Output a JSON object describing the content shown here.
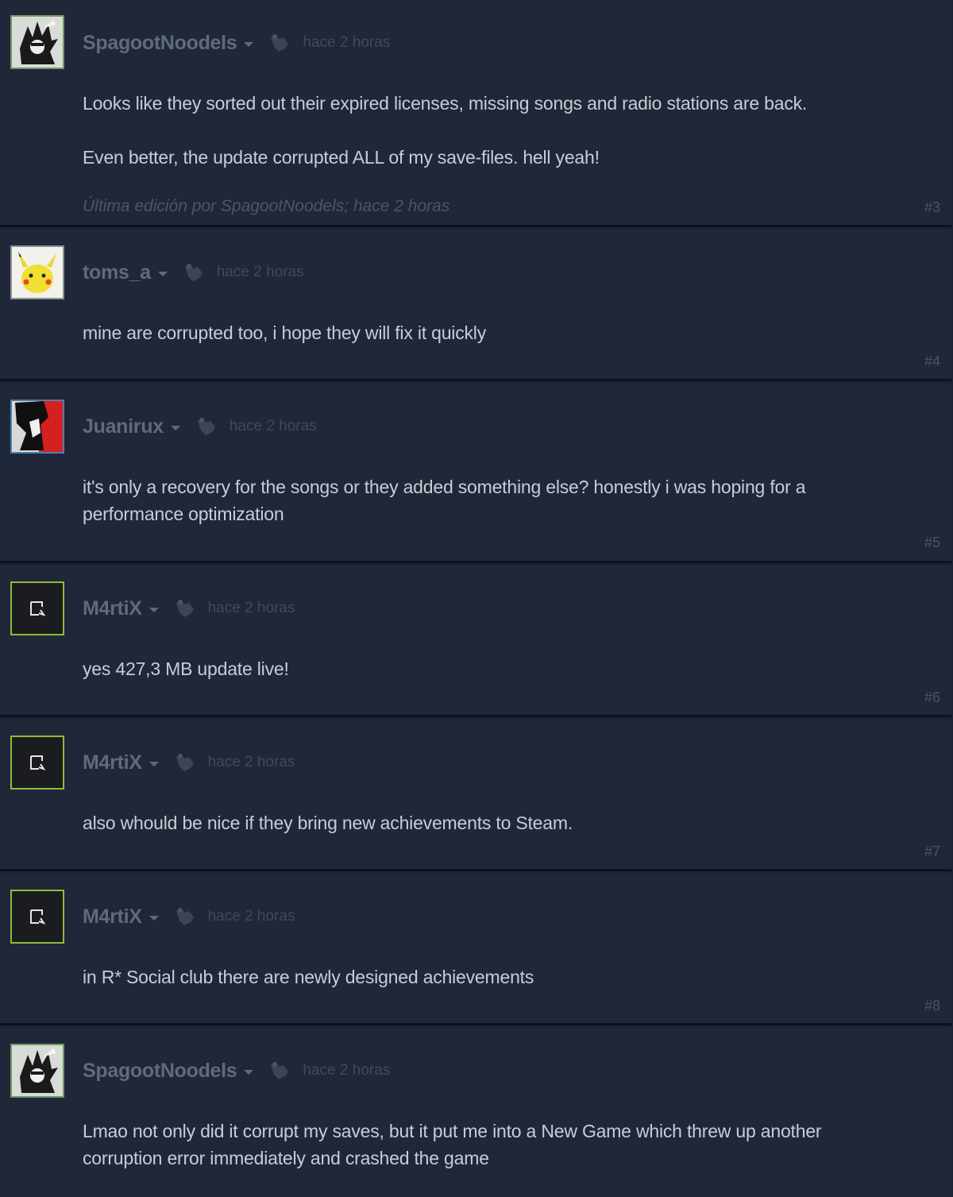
{
  "comments": [
    {
      "author": "SpagootNoodels",
      "time": "hace 2 horas",
      "avatar": "spiky-hair-anime-avatar",
      "paragraphs": [
        "Looks like they sorted out their expired licenses, missing songs and radio stations are back.",
        "Even better, the update corrupted ALL of my save-files. hell yeah!"
      ],
      "edit_note": "Última edición por SpagootNoodels; hace 2 horas",
      "number": "#3"
    },
    {
      "author": "toms_a",
      "time": "hace 2 horas",
      "avatar": "pikachu-avatar",
      "paragraphs": [
        "mine are corrupted too, i hope they will fix it quickly"
      ],
      "number": "#4"
    },
    {
      "author": "Juanirux",
      "time": "hace 2 horas",
      "avatar": "black-red-anime-avatar",
      "paragraphs": [
        "it's only a recovery for the songs or they added something else? honestly i was hoping for a performance optimization"
      ],
      "number": "#5"
    },
    {
      "author": "M4rtiX",
      "time": "hace 2 horas",
      "avatar": "broken-image-avatar",
      "paragraphs": [
        "yes 427,3 MB update live!"
      ],
      "number": "#6"
    },
    {
      "author": "M4rtiX",
      "time": "hace 2 horas",
      "avatar": "broken-image-avatar",
      "paragraphs": [
        "also whould be nice if they bring new achievements to Steam."
      ],
      "number": "#7"
    },
    {
      "author": "M4rtiX",
      "time": "hace 2 horas",
      "avatar": "broken-image-avatar",
      "paragraphs": [
        "in R* Social club there are newly designed achievements"
      ],
      "number": "#8"
    },
    {
      "author": "SpagootNoodels",
      "time": "hace 2 horas",
      "avatar": "spiky-hair-anime-avatar",
      "paragraphs": [
        "Lmao not only did it corrupt my saves, but it put me into a New Game which threw up another corruption error immediately and crashed the game"
      ]
    }
  ],
  "icons": {
    "award": "award-hand-icon",
    "dropdown": "chevron-down-icon"
  },
  "colors": {
    "background": "#1b2233",
    "card": "#1f2739",
    "author": "#5f6b7b",
    "body_text": "#c9cdd3",
    "ingame_border": "#90ba3c"
  }
}
